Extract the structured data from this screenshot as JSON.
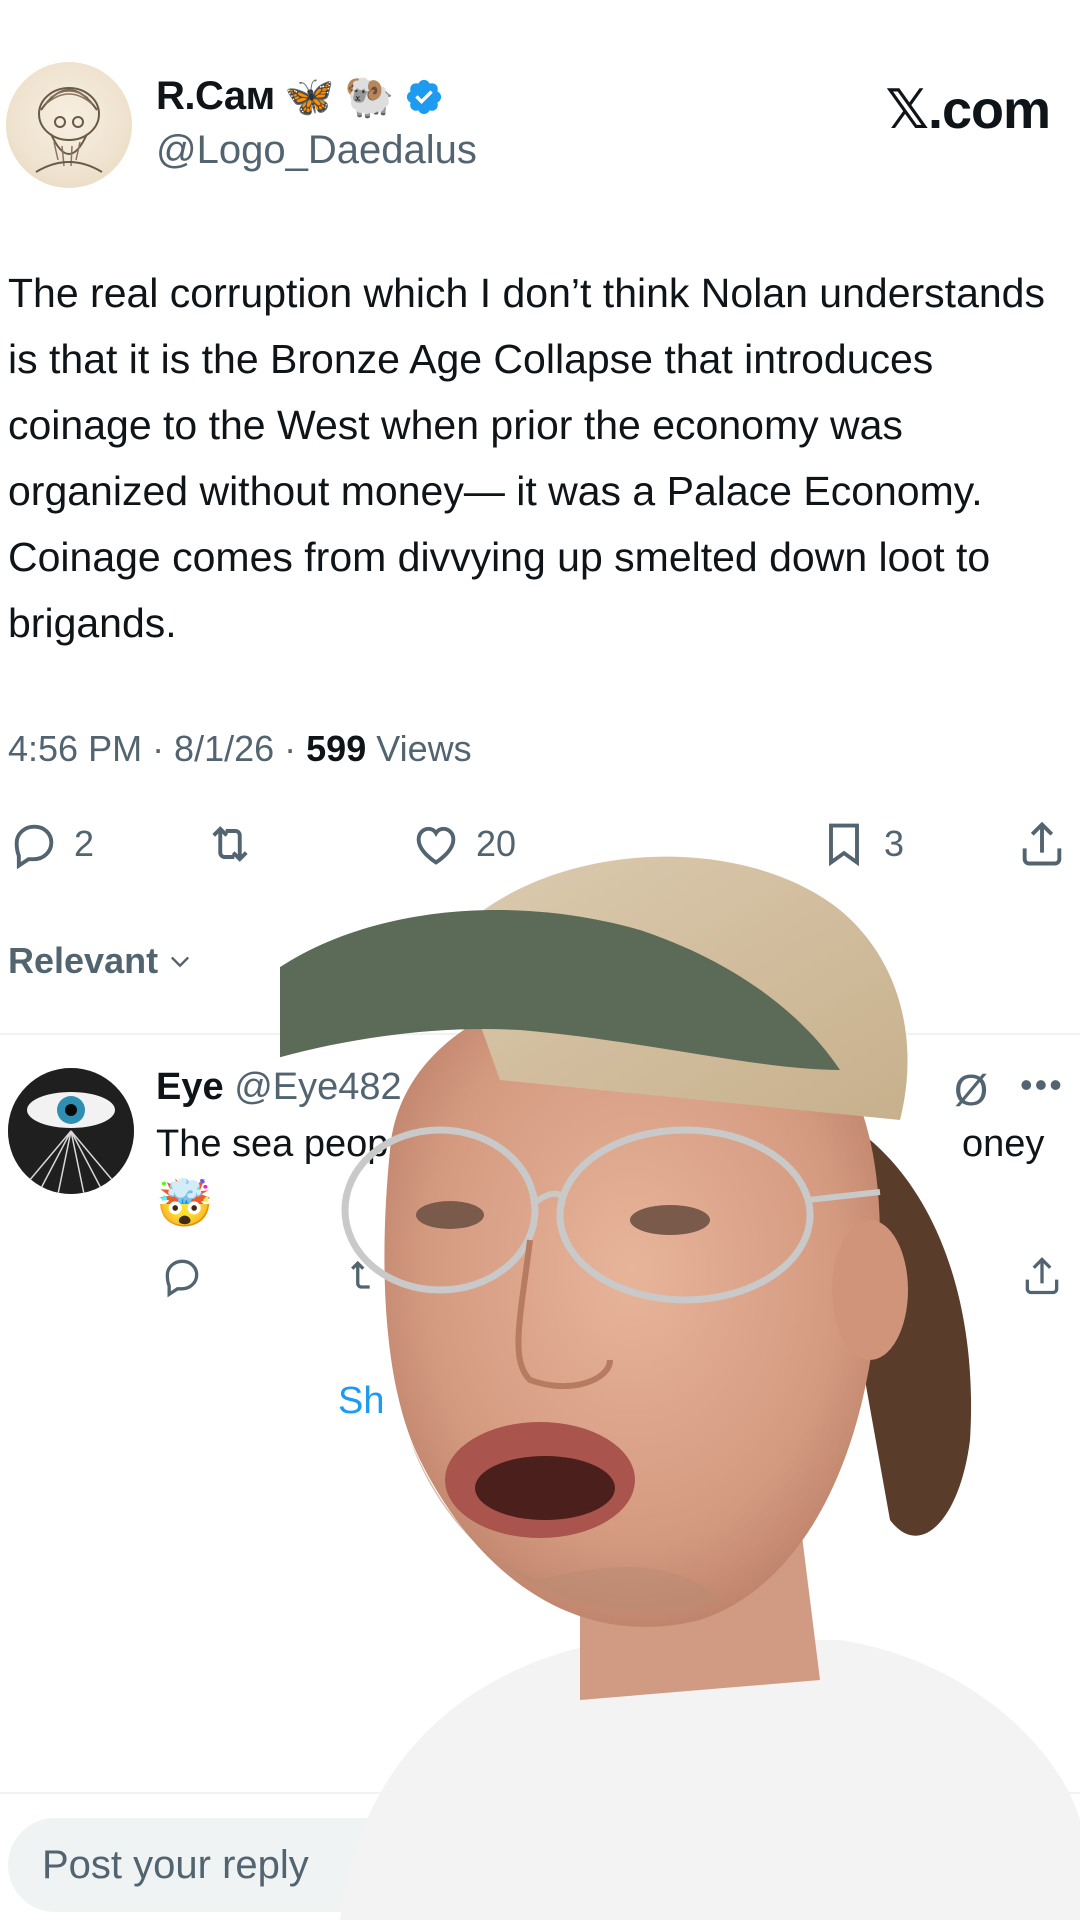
{
  "author": {
    "display_name": "R.Сам",
    "emoji_1": "🦋",
    "emoji_2": "🐏",
    "handle": "@Logo_Daedalus"
  },
  "brand": "𝕏.com",
  "tweet": {
    "text": "The real corruption which I don’t think Nolan understands is that it is the Bronze Age Collapse that introduces coinage to the West when prior the economy was organized without money— it was a Palace Economy. Coinage comes from divvying up smelted down loot to brigands.",
    "time": "4:56 PM · 8/1/26 · ",
    "views_count": "599",
    "views_label": " Views"
  },
  "actions": {
    "replies": "2",
    "likes": "20",
    "bookmarks": "3"
  },
  "sort": {
    "label": "Relevant"
  },
  "reply": {
    "name": "Eye",
    "handle": "@Eye482",
    "text_start": "The sea peop",
    "text_end": "oney",
    "emoji": "🤯"
  },
  "show_more": "Sh",
  "composer": {
    "placeholder": "Post your reply"
  },
  "colors": {
    "accent": "#1d9bf0",
    "text": "#0f1419",
    "muted": "#536471"
  }
}
